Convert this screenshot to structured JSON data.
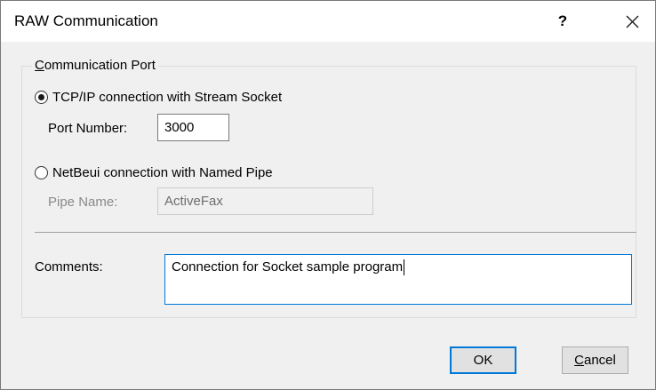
{
  "window": {
    "title": "RAW Communication",
    "help_label": "?"
  },
  "group": {
    "label": "Communication Port"
  },
  "tcp": {
    "label": "TCP/IP connection with Stream Socket",
    "selected": true,
    "port_label": "Port Number:",
    "port_value": "3000"
  },
  "netbeui": {
    "label": "NetBeui connection with Named Pipe",
    "selected": false,
    "pipe_label": "Pipe Name:",
    "pipe_value": "ActiveFax"
  },
  "comments": {
    "label": "Comments:",
    "value": "Connection for Socket sample program"
  },
  "buttons": {
    "ok": "OK",
    "cancel": "Cancel"
  },
  "colors": {
    "focus_accent": "#0078d7",
    "dialog_bg": "#f0f0f0"
  }
}
